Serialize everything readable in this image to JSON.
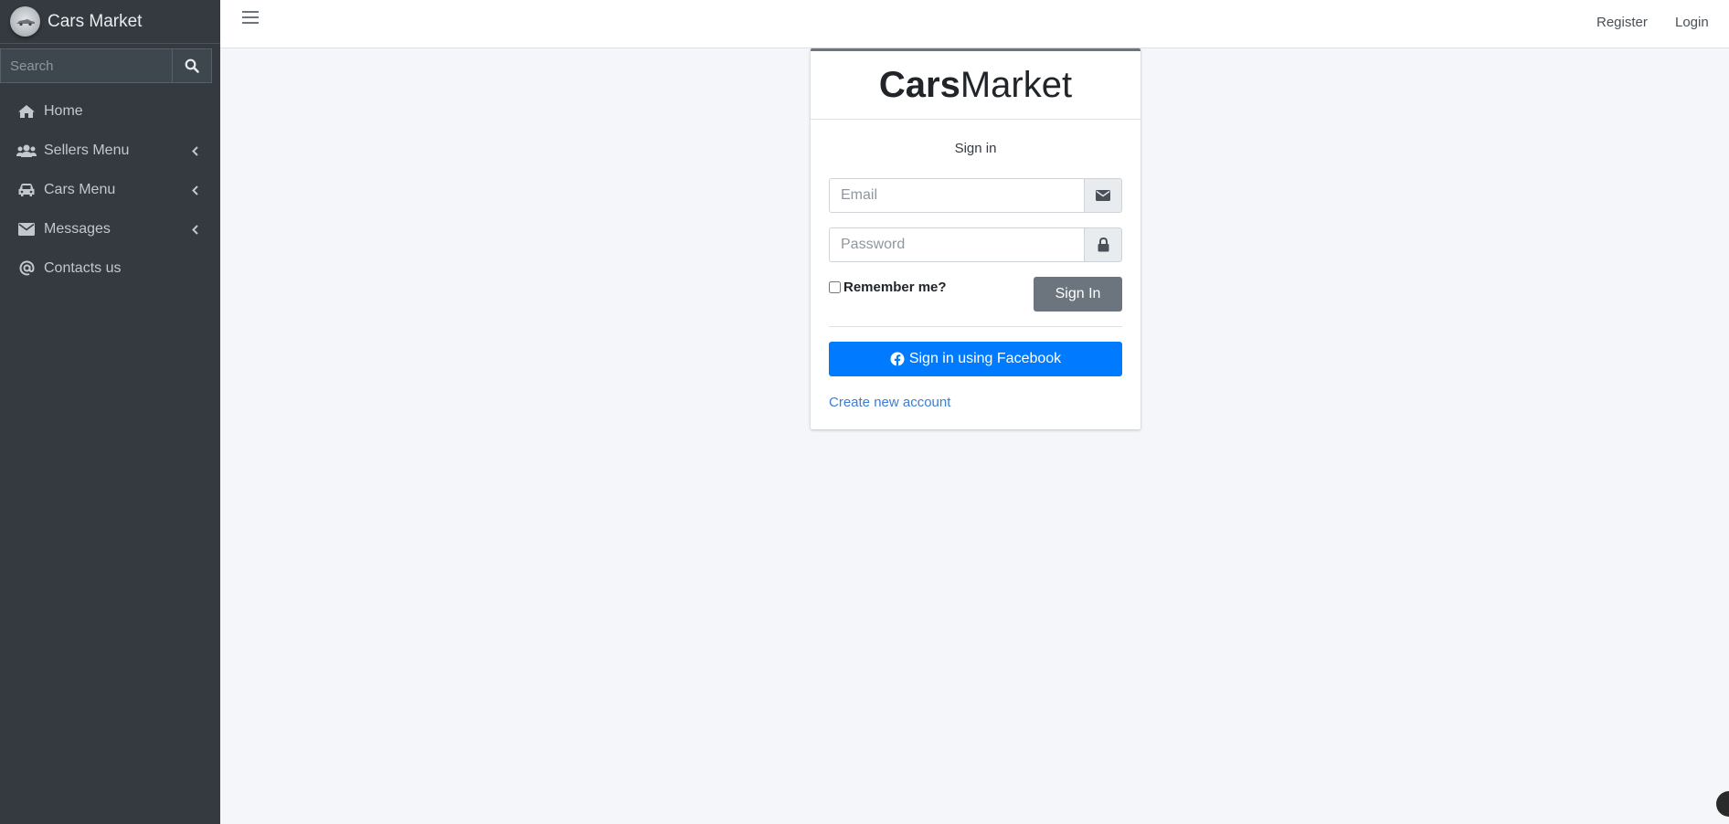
{
  "brand": {
    "title": "Cars Market",
    "logo_icon": "car-logo-icon"
  },
  "search": {
    "placeholder": "Search",
    "icon": "search-icon"
  },
  "sidebar": {
    "items": [
      {
        "label": "Home",
        "icon": "home-icon",
        "has_submenu": false
      },
      {
        "label": "Sellers Menu",
        "icon": "users-icon",
        "has_submenu": true
      },
      {
        "label": "Cars Menu",
        "icon": "car-icon",
        "has_submenu": true
      },
      {
        "label": "Messages",
        "icon": "envelope-icon",
        "has_submenu": true
      },
      {
        "label": "Contacts us",
        "icon": "at-icon",
        "has_submenu": false
      }
    ]
  },
  "topbar": {
    "register": "Register",
    "login": "Login"
  },
  "login": {
    "logo_bold": "Cars",
    "logo_light": "Market",
    "message": "Sign in",
    "email_placeholder": "Email",
    "password_placeholder": "Password",
    "remember_label": "Remember me?",
    "signin_button": "Sign In",
    "facebook_button": "Sign in using Facebook",
    "create_account": "Create new account"
  },
  "colors": {
    "sidebar_bg": "#343a40",
    "content_bg": "#f4f6f9",
    "primary": "#007bff",
    "secondary": "#6c757d",
    "link": "#3b7dd8"
  }
}
